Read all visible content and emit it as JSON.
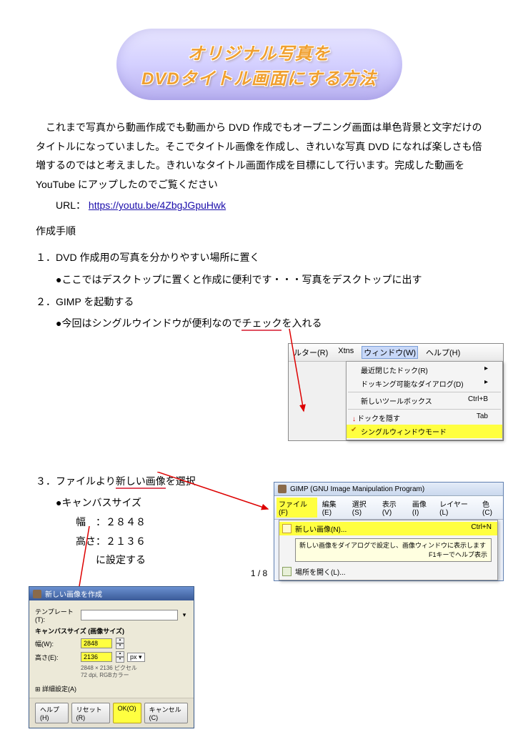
{
  "title": {
    "line1": "オリジナル写真を",
    "line2": "DVDタイトル画面にする方法"
  },
  "intro": "これまで写真から動画作成でも動画から DVD 作成でもオープニング画面は単色背景と文字だけのタイトルになっていました。そこでタイトル画像を作成し、きれいな写真 DVD になれば楽しさも倍増するのではと考えました。きれいなタイトル画面作成を目標にして行います。完成した動画を YouTube にアップしたのでご覧ください",
  "url_label": "URL：",
  "url_link": "https://youtu.be/4ZbgJGpuHwk",
  "procedure_heading": "作成手順",
  "step1": {
    "text": "１．DVD 作成用の写真を分かりやすい場所に置く",
    "sub": "●ここではデスクトップに置くと作成に便利です・・・写真をデスクトップに出す"
  },
  "step2": {
    "text": "２．GIMP を起動する",
    "sub_prefix": "●今回はシングルウインドウが便利なので",
    "sub_underlined": "チェック",
    "sub_suffix": "を入れる"
  },
  "gimp_menu": {
    "bar_left1": "ルター(R)",
    "bar_left2": "Xtns",
    "bar_window": "ウィンドウ(W)",
    "bar_help": "ヘルプ(H)",
    "items": {
      "recent": "最近閉じたドック(R)",
      "dockable": "ドッキング可能なダイアログ(D)",
      "toolbox": "新しいツールボックス",
      "toolbox_accel": "Ctrl+B",
      "hide_dock": "ドックを隠す",
      "hide_dock_accel": "Tab",
      "single": "シングルウィンドウモード"
    }
  },
  "step3": {
    "text_prefix": "３．ファイルより",
    "text_underlined": "新しい画像",
    "text_suffix": "を選択",
    "sub1": "●キャンバスサイズ",
    "sub2": "幅　：２８４８",
    "sub3": "高さ：２１３６",
    "sub4": "に設定する"
  },
  "gimp_file": {
    "title": "GIMP (GNU Image Manipulation Program)",
    "menu": {
      "file": "ファイル(F)",
      "edit": "編集(E)",
      "select": "選択(S)",
      "view": "表示(V)",
      "image": "画像(I)",
      "layer": "レイヤー(L)",
      "color": "色(C)"
    },
    "items": {
      "new": "新しい画像(N)...",
      "new_accel": "Ctrl+N",
      "tooltip1": "新しい画像をダイアログで設定し、画像ウィンドウに表示します",
      "tooltip2": "F1キーでヘルプ表示",
      "open_loc": "場所を開く(L)..."
    }
  },
  "dialog": {
    "title": "新しい画像を作成",
    "template_label": "テンプレート(T):",
    "canvas_label": "キャンバスサイズ (画像サイズ)",
    "width_label": "幅(W):",
    "width_value": "2848",
    "height_label": "高さ(E):",
    "height_value": "2136",
    "unit": "px ▾",
    "info1": "2848 × 2136 ピクセル",
    "info2": "72 dpi, RGBカラー",
    "advanced": "⊞ 詳細設定(A)",
    "btn_help": "ヘルプ(H)",
    "btn_reset": "リセット(R)",
    "btn_ok": "OK(O)",
    "btn_cancel": "キャンセル(C)"
  },
  "pager": "1 / 8"
}
